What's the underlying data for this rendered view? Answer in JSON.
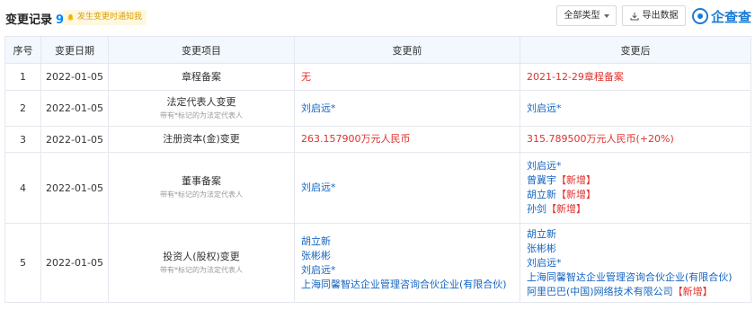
{
  "header": {
    "title": "变更记录",
    "count": "9",
    "notify_text": "发生变更时通知我",
    "filter_button": "全部类型",
    "export_button": "导出数据",
    "logo_text": "企查查"
  },
  "table": {
    "columns": [
      "序号",
      "变更日期",
      "变更项目",
      "变更前",
      "变更后"
    ],
    "rows": [
      {
        "idx": "1",
        "date": "2022-01-05",
        "item": "章程备案",
        "item_hint": "",
        "before": [
          "无"
        ],
        "after": [
          "2021-12-29章程备案"
        ]
      },
      {
        "idx": "2",
        "date": "2022-01-05",
        "item": "法定代表人变更",
        "item_hint": "带有*标记的为法定代表人",
        "before": [
          "刘启远*"
        ],
        "after": [
          "刘启远*"
        ]
      },
      {
        "idx": "3",
        "date": "2022-01-05",
        "item": "注册资本(金)变更",
        "item_hint": "",
        "before": [
          "263.157900万元人民币"
        ],
        "after": [
          "315.789500万元人民币(+20%)"
        ]
      },
      {
        "idx": "4",
        "date": "2022-01-05",
        "item": "董事备案",
        "item_hint": "带有*标记的为法定代表人",
        "before": [
          "刘启远*"
        ],
        "after": [
          {
            "name": "刘启远*",
            "tag": ""
          },
          {
            "name": "曾冀宇",
            "tag": "【新增】"
          },
          {
            "name": "胡立新",
            "tag": "【新增】"
          },
          {
            "name": "孙剑",
            "tag": "【新增】"
          }
        ]
      },
      {
        "idx": "5",
        "date": "2022-01-05",
        "item": "投资人(股权)变更",
        "item_hint": "带有*标记的为法定代表人",
        "before": [
          "胡立新",
          "张彬彬",
          "刘启远*",
          "上海同馨智达企业管理咨询合伙企业(有限合伙)"
        ],
        "after": [
          {
            "name": "胡立新",
            "tag": ""
          },
          {
            "name": "张彬彬",
            "tag": ""
          },
          {
            "name": "刘启远*",
            "tag": ""
          },
          {
            "name": "上海同馨智达企业管理咨询合伙企业(有限合伙)",
            "tag": ""
          },
          {
            "name": "阿里巴巴(中国)网络技术有限公司",
            "tag": "【新增】"
          }
        ]
      }
    ]
  }
}
